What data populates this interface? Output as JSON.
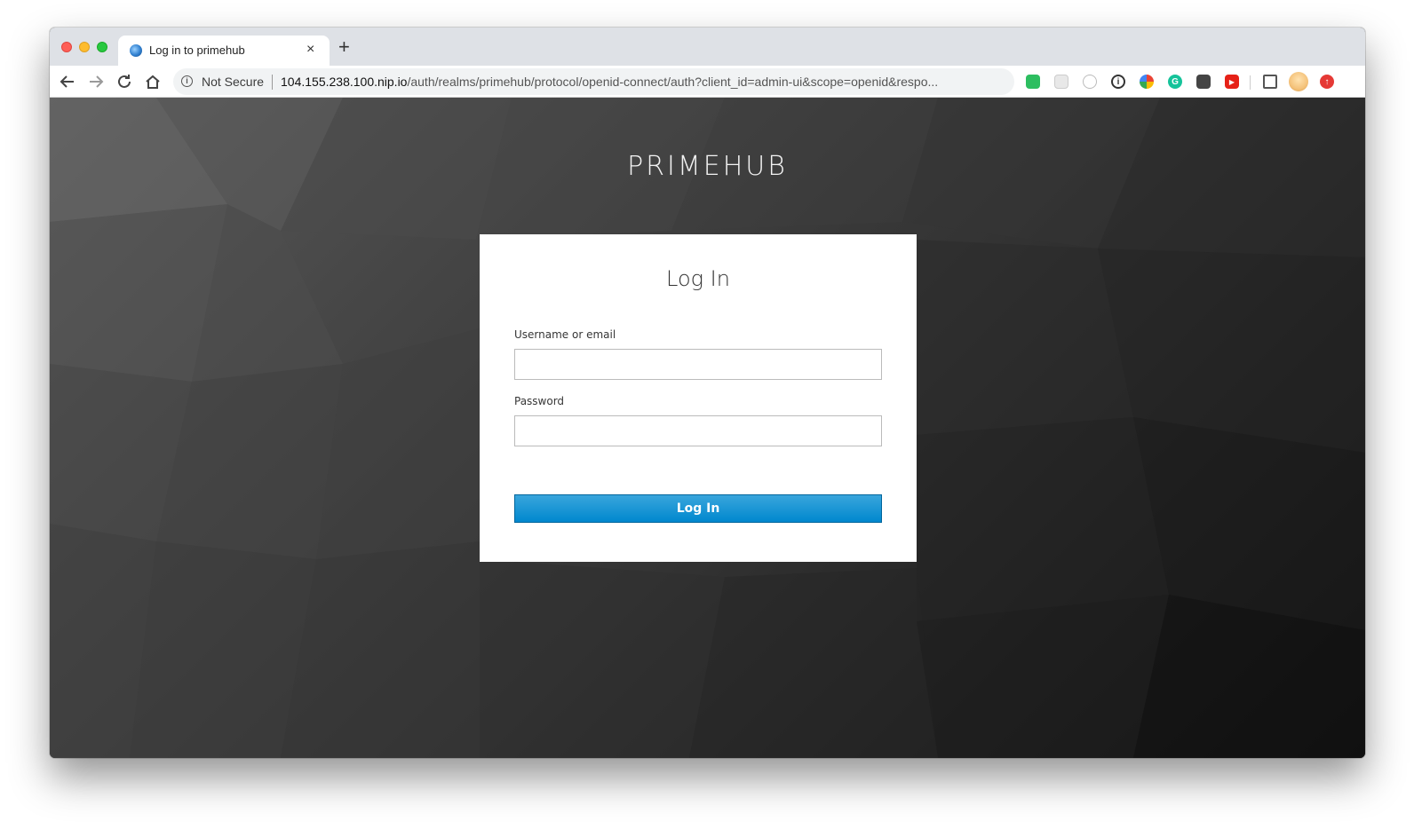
{
  "browser": {
    "tab_title": "Log in to primehub",
    "tab_close": "×",
    "new_tab": "+",
    "security_label": "Not Secure",
    "url_host": "104.155.238.100.nip.io",
    "url_path": "/auth/realms/primehub/protocol/openid-connect/auth?client_id=admin-ui&scope=openid&respo...",
    "nav": {
      "back": "←",
      "forward": "→",
      "reload": "↻",
      "home": "⌂",
      "bookmark": "☆"
    },
    "extensions": [
      {
        "name": "evernote-extension-icon",
        "color": "#2dbe60",
        "glyph": ""
      },
      {
        "name": "blank-extension-icon",
        "color": "#e8e8e8",
        "glyph": ""
      },
      {
        "name": "dial-extension-icon",
        "color": "#d0d0d0",
        "glyph": ""
      },
      {
        "name": "onepassword-extension-icon",
        "color": "#333333",
        "glyph": "i"
      },
      {
        "name": "chrome-colorful-extension-icon",
        "color": "#fbbc05",
        "glyph": ""
      },
      {
        "name": "grammarly-extension-icon",
        "color": "#15c39a",
        "glyph": "G"
      },
      {
        "name": "pocket-extension-icon",
        "color": "#444444",
        "glyph": ""
      },
      {
        "name": "youtube-extension-icon",
        "color": "#e62117",
        "glyph": "▶"
      },
      {
        "name": "cast-icon",
        "color": "#ffffff",
        "glyph": ""
      },
      {
        "name": "profile-avatar",
        "color": "#f4c27a",
        "glyph": ""
      },
      {
        "name": "update-icon",
        "color": "#e53935",
        "glyph": "↑"
      }
    ]
  },
  "page": {
    "brand": "PRIMEHUB",
    "login": {
      "title": "Log In",
      "username_label": "Username or email",
      "username_value": "",
      "password_label": "Password",
      "password_value": "",
      "submit_label": "Log In"
    }
  },
  "colors": {
    "primary_button": "#0088ce",
    "background_dark": "#2b2b2b"
  }
}
